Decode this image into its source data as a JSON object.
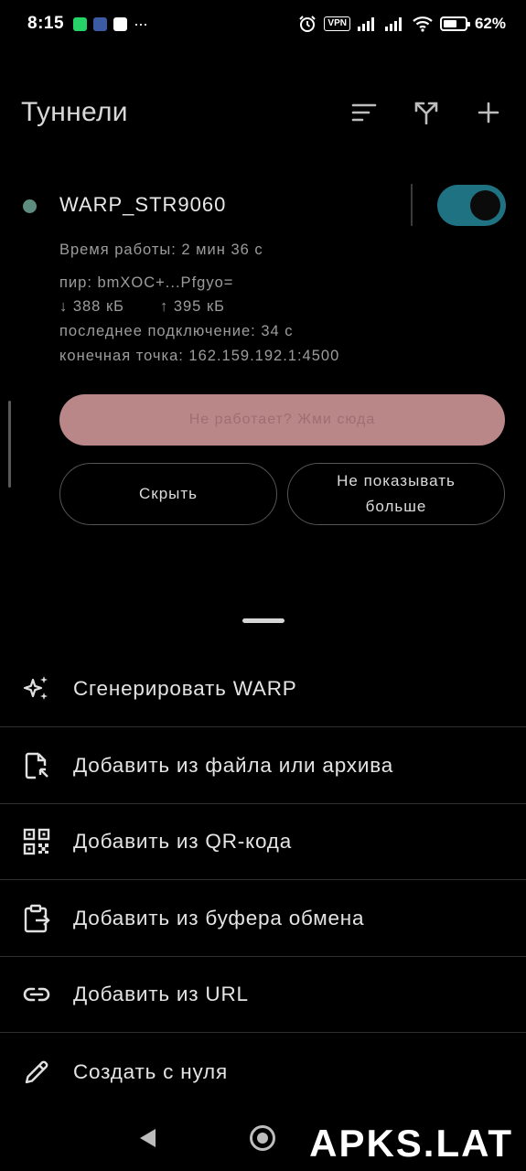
{
  "status_bar": {
    "time": "8:15",
    "dots": "···",
    "vpn": "VPN",
    "battery": "62%",
    "battery_level": 0.62
  },
  "header": {
    "title": "Туннели",
    "actions": [
      {
        "icon": "sort-icon"
      },
      {
        "icon": "split-tunnel-icon"
      },
      {
        "icon": "add-icon"
      }
    ]
  },
  "tunnel": {
    "name": "WARP_STR9060",
    "enabled": true,
    "uptime": "Время работы: 2 мин 36 с",
    "peer": "пир: bmXOC+...Pfgyo=",
    "rx": "↓ 388 кБ",
    "tx": "↑ 395 кБ",
    "last_handshake": "последнее подключение: 34 с",
    "endpoint": "конечная точка: 162.159.192.1:4500",
    "not_working_button": "Не работает? Жми сюда",
    "hide_button": "Скрыть",
    "dont_show_line1": "Не показывать",
    "dont_show_line2": "больше"
  },
  "sheet": {
    "items": [
      {
        "label": "Сгенерировать WARP",
        "icon": "sparkle-icon"
      },
      {
        "label": "Добавить из файла или архива",
        "icon": "file-import-icon"
      },
      {
        "label": "Добавить из QR-кода",
        "icon": "qr-code-icon"
      },
      {
        "label": "Добавить из буфера обмена",
        "icon": "clipboard-icon"
      },
      {
        "label": "Добавить из URL",
        "icon": "link-icon"
      },
      {
        "label": "Создать с нуля",
        "icon": "pencil-icon"
      }
    ]
  },
  "colors": {
    "accent": "#1f7282",
    "status_dot": "#5e8d7f",
    "pink_button": "#b98788"
  },
  "watermark": "APKS.LAT"
}
